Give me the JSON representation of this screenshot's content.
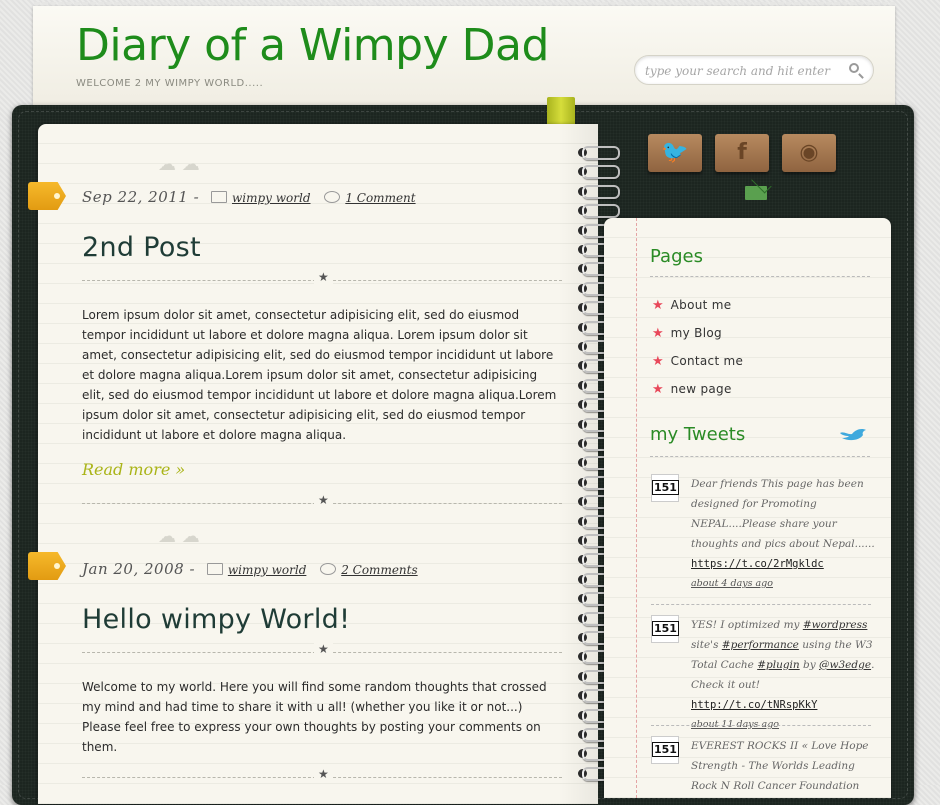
{
  "header": {
    "title": "Diary of a Wimpy Dad",
    "tagline": "WELCOME 2 MY WIMPY WORLD.....",
    "search_placeholder": "type your search and hit enter"
  },
  "social": {
    "icons": [
      "twitter-icon",
      "facebook-icon",
      "rss-icon",
      "mail-icon"
    ]
  },
  "posts": [
    {
      "date": "Sep 22, 2011 -",
      "category": "wimpy world",
      "comments": "1 Comment",
      "title": "2nd Post",
      "body": "Lorem ipsum dolor sit amet, consectetur adipisicing elit, sed do eiusmod tempor incididunt ut labore et dolore magna aliqua. Lorem ipsum dolor sit amet, consectetur adipisicing elit, sed do eiusmod tempor incididunt ut labore et dolore magna aliqua.Lorem ipsum dolor sit amet, consectetur adipisicing elit, sed do eiusmod tempor incididunt ut labore et dolore magna aliqua.Lorem ipsum dolor sit amet, consectetur adipisicing elit, sed do eiusmod tempor incididunt ut labore et dolore magna aliqua.",
      "read_more": "Read more »"
    },
    {
      "date": "Jan 20, 2008 -",
      "category": "wimpy world",
      "comments": "2 Comments",
      "title": "Hello wimpy World!",
      "body_lines": [
        "Welcome to my world. Here you will find some random thoughts that crossed my mind and had time to share it with u all! (whether you like it or not...)",
        "Please feel free to express your own thoughts by posting your comments on them."
      ]
    }
  ],
  "sidebar": {
    "pages_title": "Pages",
    "pages": [
      "About me",
      "my Blog",
      "Contact me",
      "new page"
    ],
    "tweets_title": "my Tweets",
    "tweets": [
      {
        "avatar": "151",
        "text": "Dear friends This page has been designed for Promoting NEPAL....Please share your thoughts and pics about Nepal......",
        "link": "https://t.co/2rMgkldc",
        "time": "about 4 days ago"
      },
      {
        "avatar": "151",
        "text_a": "YES! I optimized my ",
        "tag1": "#wordpress",
        "text_b": " site's ",
        "tag2": "#performance",
        "text_c": " using the W3 Total Cache ",
        "tag3": "#plugin",
        "text_d": " by ",
        "tag4": "@w3edge",
        "text_e": ". Check it out! ",
        "link": "http://t.co/tNRspKkY",
        "time": "about 11 days ago"
      },
      {
        "avatar": "151",
        "text": "EVEREST ROCKS II « Love Hope Strength - The Worlds Leading Rock N Roll Cancer Foundation"
      }
    ]
  },
  "colors": {
    "title_green": "#1e8c1b",
    "widget_green": "#2a8b25",
    "read_more": "#aab418",
    "cover": "#1c2520",
    "paper": "#f8f6ee",
    "tag_orange": "#f0aa1e",
    "star_red": "#e8485a"
  }
}
